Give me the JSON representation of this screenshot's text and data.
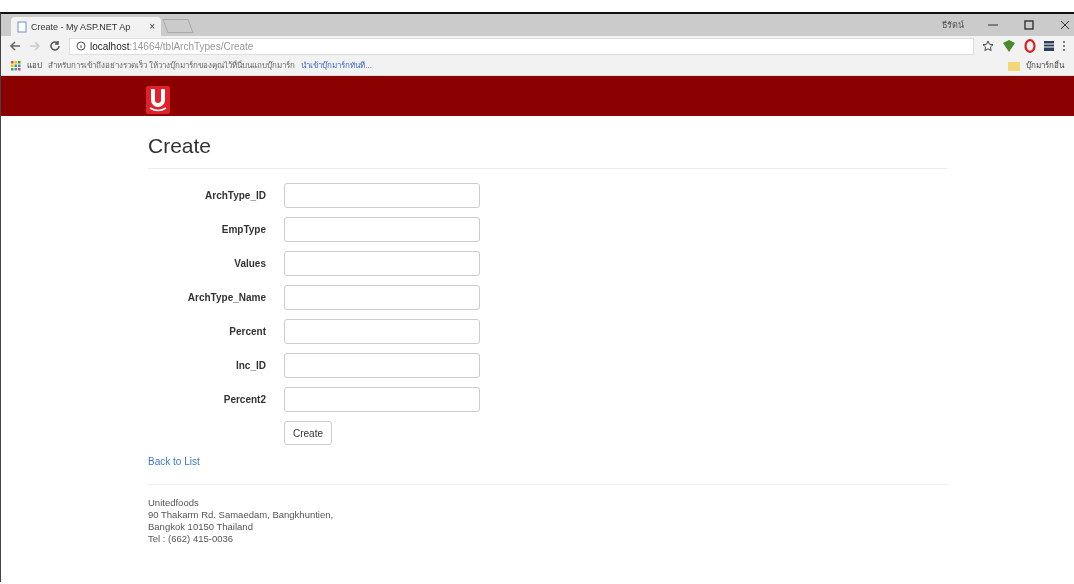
{
  "browser": {
    "tab_title": "Create - My ASP.NET Ap",
    "tab_close": "×",
    "user": "ธีรัตน์",
    "url_host": "localhost",
    "url_path": ":14664/tblArchTypes/Create",
    "bookmarks_apps": "แอป",
    "bookmarks_hint": "สำหรับการเข้าถึงอย่างรวดเร็ว ให้วางบุ๊กมาร์กของคุณไว้ที่นี่บนแถบบุ๊กมาร์ก",
    "bookmarks_import": "นำเข้าบุ๊กมาร์กทันที...",
    "other_bookmarks": "บุ๊กมาร์กอื่น"
  },
  "page": {
    "title": "Create",
    "fields": [
      {
        "label": "ArchType_ID"
      },
      {
        "label": "EmpType"
      },
      {
        "label": "Values"
      },
      {
        "label": "ArchType_Name"
      },
      {
        "label": "Percent"
      },
      {
        "label": "Inc_ID"
      },
      {
        "label": "Percent2"
      }
    ],
    "submit": "Create",
    "back_link": "Back to List",
    "footer": [
      "Unitedfoods",
      "90 Thakarm Rd. Samaedam, Bangkhuntien,",
      "Bangkok 10150 Thailand",
      "Tel : (662) 415-0036"
    ]
  }
}
